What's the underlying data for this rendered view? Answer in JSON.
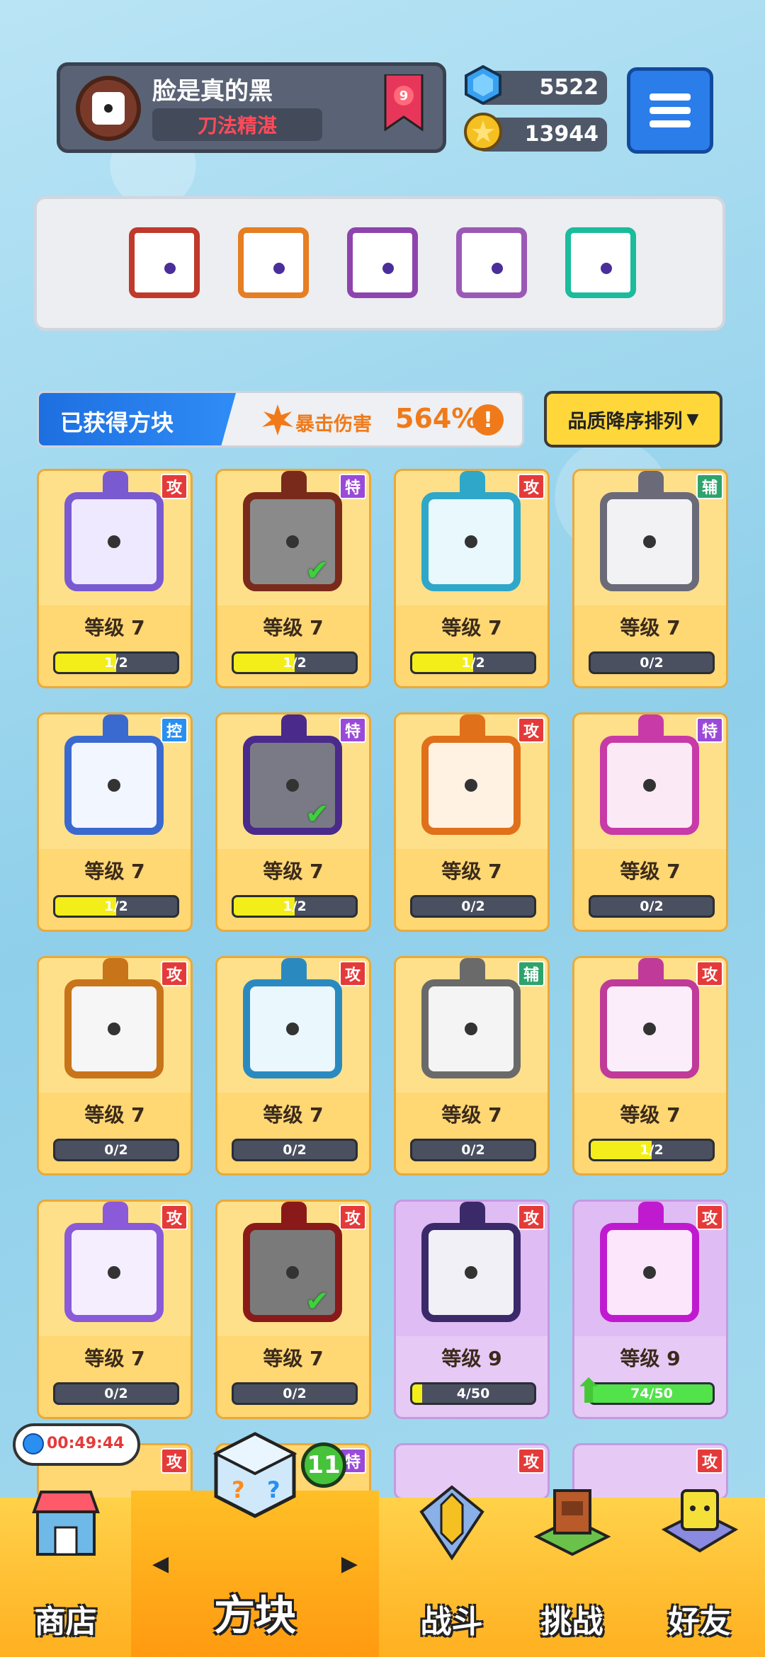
{
  "player": {
    "name": "脸是真的黑",
    "title": "刀法精湛",
    "rank": "9"
  },
  "currency": {
    "gems": "5522",
    "coins": "13944"
  },
  "equipped": [
    {
      "name": "saw-blade",
      "color": "#c0392b"
    },
    {
      "name": "infinity",
      "color": "#e67e22"
    },
    {
      "name": "purple-wave",
      "color": "#8e44ad"
    },
    {
      "name": "cracked-purple",
      "color": "#9b59b6"
    },
    {
      "name": "hands-cyan",
      "color": "#1abc9c"
    }
  ],
  "stats": {
    "obtained_label": "已获得方块",
    "crit_label": "暴击伤害",
    "crit_value": "564%",
    "info": "!"
  },
  "sort": {
    "label": "品质降序排列",
    "caret": "▼"
  },
  "cards": [
    {
      "level": "等级 7",
      "progress": "1/2",
      "fill": 0.5,
      "badge": "攻",
      "type": "atk",
      "frame": "#7a5ad0",
      "bg": "#efe9ff",
      "checked": false
    },
    {
      "level": "等级 7",
      "progress": "1/2",
      "fill": 0.5,
      "badge": "特",
      "type": "spc",
      "frame": "#7a2a1a",
      "bg": "#8a8a8a",
      "checked": true
    },
    {
      "level": "等级 7",
      "progress": "1/2",
      "fill": 0.5,
      "badge": "攻",
      "type": "atk",
      "frame": "#2fa7c9",
      "bg": "#e8f8fc",
      "checked": false
    },
    {
      "level": "等级 7",
      "progress": "0/2",
      "fill": 0,
      "badge": "辅",
      "type": "sup",
      "frame": "#6a6a78",
      "bg": "#f2f2f4",
      "checked": false
    },
    {
      "level": "等级 7",
      "progress": "1/2",
      "fill": 0.5,
      "badge": "控",
      "type": "ctl",
      "frame": "#3a6ad0",
      "bg": "#f2f6ff",
      "checked": false
    },
    {
      "level": "等级 7",
      "progress": "1/2",
      "fill": 0.5,
      "badge": "特",
      "type": "spc",
      "frame": "#4a2a8a",
      "bg": "#7a7a86",
      "checked": true
    },
    {
      "level": "等级 7",
      "progress": "0/2",
      "fill": 0,
      "badge": "攻",
      "type": "atk",
      "frame": "#e0701a",
      "bg": "#fff2e2",
      "checked": false
    },
    {
      "level": "等级 7",
      "progress": "0/2",
      "fill": 0,
      "badge": "特",
      "type": "spc",
      "frame": "#c83aa8",
      "bg": "#fbeaf6",
      "checked": false
    },
    {
      "level": "等级 7",
      "progress": "0/2",
      "fill": 0,
      "badge": "攻",
      "type": "atk",
      "frame": "#c8741a",
      "bg": "#f6f6f6",
      "checked": false
    },
    {
      "level": "等级 7",
      "progress": "0/2",
      "fill": 0,
      "badge": "攻",
      "type": "atk",
      "frame": "#2a8ac0",
      "bg": "#eaf7fc",
      "checked": false
    },
    {
      "level": "等级 7",
      "progress": "0/2",
      "fill": 0,
      "badge": "辅",
      "type": "sup",
      "frame": "#6a6a6a",
      "bg": "#f4f4f4",
      "checked": false
    },
    {
      "level": "等级 7",
      "progress": "1/2",
      "fill": 0.5,
      "badge": "攻",
      "type": "atk",
      "frame": "#c03a9a",
      "bg": "#fbeefa",
      "checked": false
    },
    {
      "level": "等级 7",
      "progress": "0/2",
      "fill": 0,
      "badge": "攻",
      "type": "atk",
      "frame": "#8a5ad8",
      "bg": "#f4eeff",
      "checked": false
    },
    {
      "level": "等级 7",
      "progress": "0/2",
      "fill": 0,
      "badge": "攻",
      "type": "atk",
      "frame": "#8a1a1a",
      "bg": "#7a7a7a",
      "checked": true
    },
    {
      "level": "等级 9",
      "progress": "4/50",
      "fill": 0.08,
      "badge": "攻",
      "type": "atk",
      "frame": "#3a2a6a",
      "bg": "#f0f0f6",
      "checked": false,
      "purple": true
    },
    {
      "level": "等级 9",
      "progress": "74/50",
      "fill": 1,
      "badge": "攻",
      "type": "atk",
      "frame": "#c01ad0",
      "bg": "#fbe6fc",
      "checked": false,
      "purple": true,
      "upgrade": true
    }
  ],
  "partial_cards": [
    {
      "badge": "攻",
      "type": "atk"
    },
    {
      "badge": "特",
      "type": "spc"
    },
    {
      "badge": "攻",
      "type": "atk"
    },
    {
      "badge": "攻",
      "type": "atk"
    }
  ],
  "timer": "00:49:44",
  "notification_count": "11",
  "nav": {
    "shop": "商店",
    "blocks": "方块",
    "battle": "战斗",
    "challenge": "挑战",
    "friends": "好友",
    "left_arrow": "◀",
    "right_arrow": "▶"
  }
}
